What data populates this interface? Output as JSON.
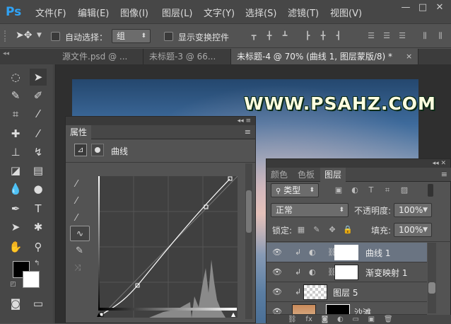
{
  "app": {
    "logo": "Ps"
  },
  "menu": [
    "文件(F)",
    "编辑(E)",
    "图像(I)",
    "图层(L)",
    "文字(Y)",
    "选择(S)",
    "滤镜(T)",
    "视图(V)"
  ],
  "window_controls": {
    "minimize": "—",
    "restore": "□",
    "close": "✕"
  },
  "options": {
    "auto_select_label": "自动选择：",
    "auto_select_value": "组",
    "show_transform_label": "显示变换控件",
    "auto_select_checked": false,
    "show_transform_checked": false
  },
  "tabs": [
    {
      "label": "源文件.psd @ ...",
      "active": false
    },
    {
      "label": "未标题-3 @ 66...",
      "active": false
    },
    {
      "label": "未标题-4 @ 70% (曲线 1, 图层蒙版/8) *",
      "active": true
    }
  ],
  "canvas": {
    "watermark": "WWW.PSAHZ.COM"
  },
  "properties": {
    "title": "属性",
    "adjustment": "曲线",
    "collapse": "◂◂ ≡"
  },
  "layers_panel": {
    "tabs": [
      {
        "label": "颜色",
        "active": false
      },
      {
        "label": "色板",
        "active": false
      },
      {
        "label": "图层",
        "active": true
      }
    ],
    "filter_label": "类型",
    "blend_mode": "正常",
    "opacity_label": "不透明度:",
    "opacity_value": "100%",
    "lock_label": "锁定:",
    "fill_label": "填充:",
    "fill_value": "100%",
    "layers": [
      {
        "name": "曲线 1",
        "selected": true,
        "thumb": "white"
      },
      {
        "name": "渐变映射 1",
        "selected": false,
        "thumb": "white"
      },
      {
        "name": "图层 5",
        "selected": false,
        "thumb": "checker"
      },
      {
        "name": "沙滩",
        "selected": false,
        "thumb": "photo"
      }
    ]
  },
  "colors": {
    "accent": "#2fa3f6",
    "selected_row": "#6a7482"
  }
}
